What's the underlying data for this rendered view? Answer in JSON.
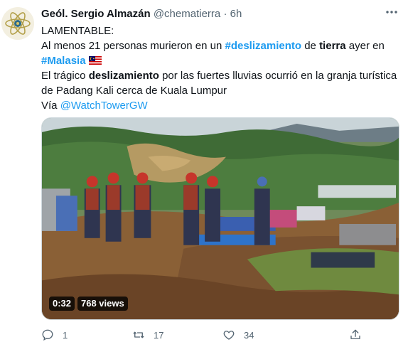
{
  "author": {
    "name": "Geól. Sergio Almazán",
    "handle": "@chematierra",
    "separator": "·",
    "time": "6h"
  },
  "tweet": {
    "line1": "LAMENTABLE:",
    "line2_pre": "Al menos 21 personas murieron en un ",
    "line2_hashtag": "#deslizamiento",
    "line2_mid": " de ",
    "line2_bold": "tierra",
    "line2_post": " ayer en",
    "line3_hashtag": "#Malasia",
    "line4_pre": "El trágico ",
    "line4_bold": "deslizamiento",
    "line4_post": " por las fuertes lluvias ocurrió en la granja turística",
    "line5": "de Padang Kali cerca de Kuala Lumpur",
    "line6_pre": "Vía ",
    "line6_mention": "@WatchTowerGW"
  },
  "media": {
    "duration": "0:32",
    "views": "768 views"
  },
  "actions": {
    "reply_count": "1",
    "retweet_count": "17",
    "like_count": "34"
  },
  "colors": {
    "link": "#1d9bf0",
    "text": "#0f1419",
    "muted": "#536471"
  },
  "icons": {
    "avatar": "atom-logo-icon",
    "more": "more-dots-icon",
    "flag": "malaysia-flag-icon",
    "reply": "reply-icon",
    "retweet": "retweet-icon",
    "like": "heart-icon",
    "share": "share-icon"
  }
}
